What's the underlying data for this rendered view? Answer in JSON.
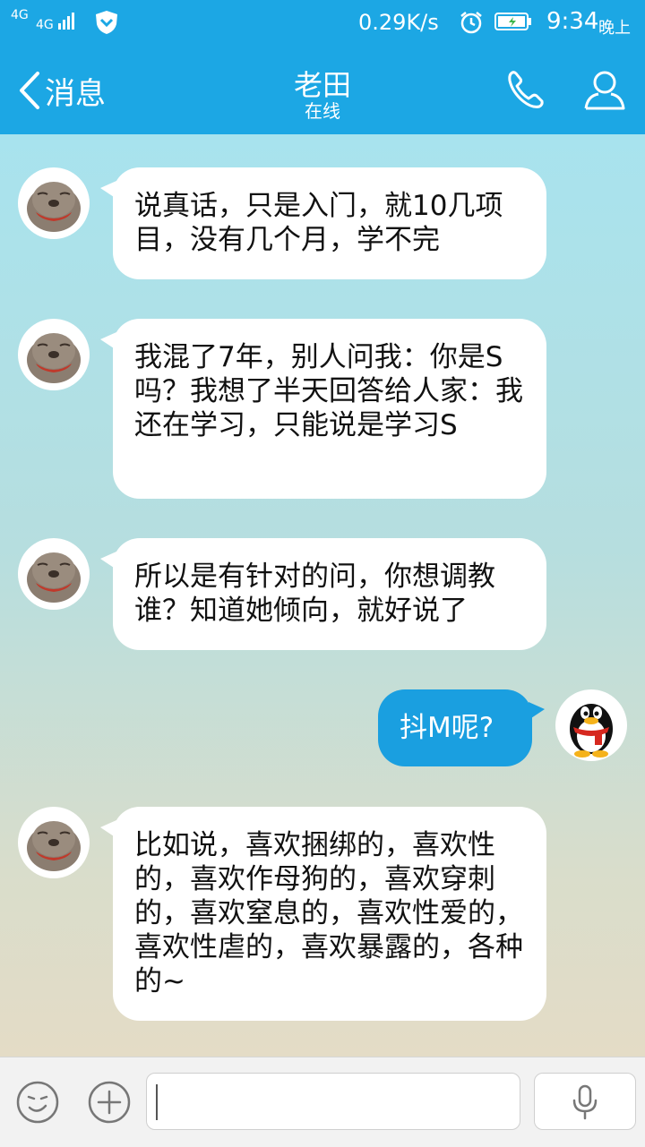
{
  "status_bar": {
    "network_top": "4G",
    "network_second": "4G",
    "speed": "0.29K/s",
    "time": "9:34",
    "ampm": "晚上"
  },
  "header": {
    "back_label": "消息",
    "title": "老田",
    "subtitle": "在线"
  },
  "messages": [
    {
      "side": "in",
      "text": "说真话，只是入门，就10几项目，没有几个月，学不完"
    },
    {
      "side": "in",
      "text": "我混了7年，别人问我：你是S吗？我想了半天回答给人家：我还在学习，只能说是学习S"
    },
    {
      "side": "in",
      "text": "所以是有针对的问，你想调教谁？知道她倾向，就好说了"
    },
    {
      "side": "out",
      "text": "抖M呢?"
    },
    {
      "side": "in",
      "text": "比如说，喜欢捆绑的，喜欢性的，喜欢作母狗的，喜欢穿刺的，喜欢窒息的，喜欢性爱的，喜欢性虐的，喜欢暴露的，各种的~"
    }
  ],
  "input": {
    "value": ""
  },
  "colors": {
    "header_bg": "#1CA7E4",
    "out_bubble": "#1A9FE0",
    "in_bubble": "#FFFFFF"
  }
}
